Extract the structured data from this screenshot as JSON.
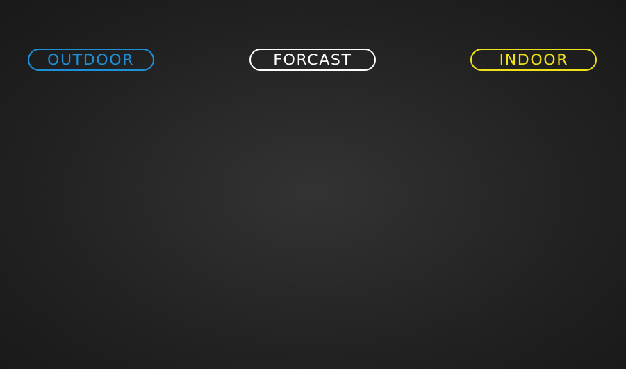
{
  "tabs": [
    {
      "id": "outdoor",
      "label": "OUTDOOR",
      "color": "#1e90d8"
    },
    {
      "id": "forcast",
      "label": "FORCAST",
      "color": "#ffffff"
    },
    {
      "id": "indoor",
      "label": "INDOOR",
      "color": "#f0e21a"
    }
  ]
}
